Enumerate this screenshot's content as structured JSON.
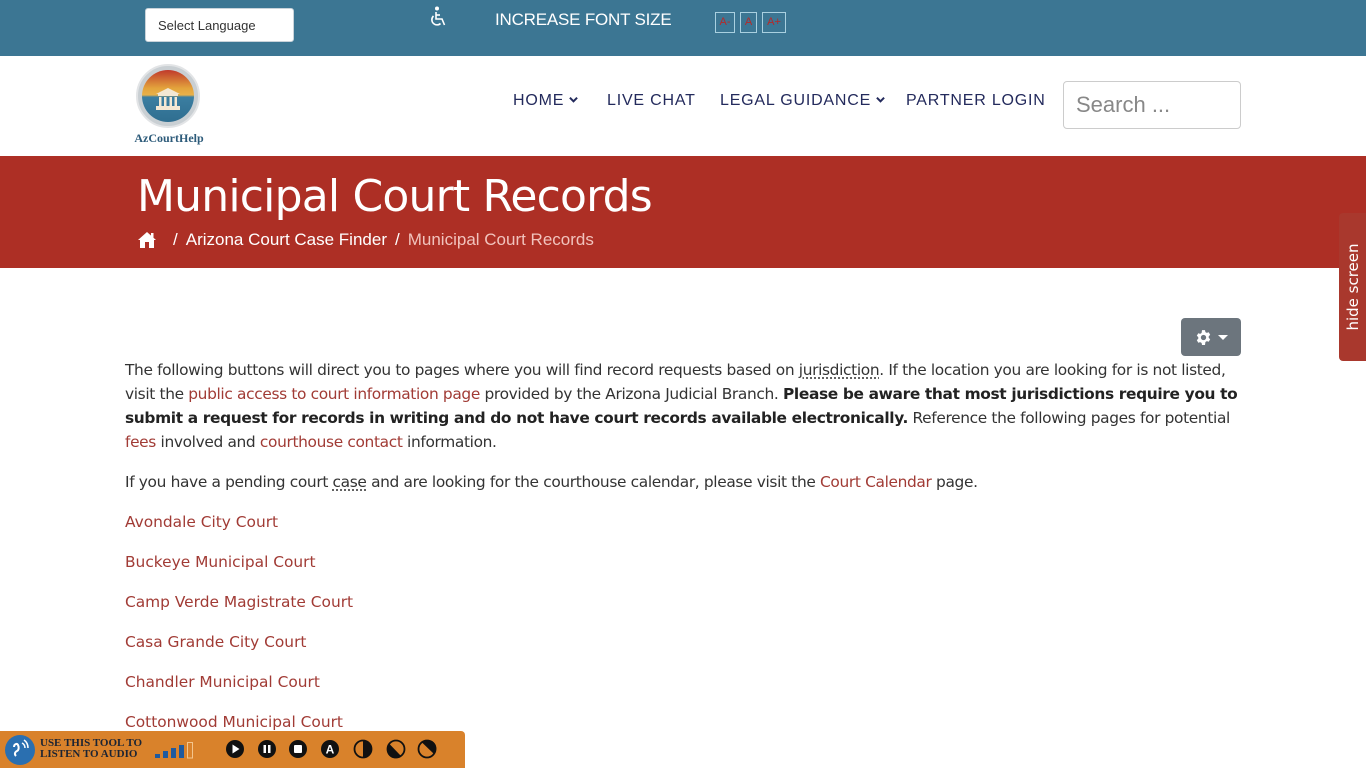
{
  "topbar": {
    "language_select": "Select Language",
    "accessibility_icon": "wheelchair-icon",
    "font_size_label": "INCREASE FONT SIZE",
    "font_buttons": [
      "A-",
      "A",
      "A+"
    ]
  },
  "header": {
    "logo_text": "AzCourtHelp",
    "nav": [
      {
        "label": "HOME",
        "has_dropdown": true
      },
      {
        "label": "LIVE CHAT",
        "has_dropdown": false
      },
      {
        "label": "LEGAL GUIDANCE",
        "has_dropdown": true
      },
      {
        "label": "PARTNER LOGIN",
        "has_dropdown": false
      }
    ],
    "search_placeholder": "Search ..."
  },
  "banner": {
    "title": "Municipal Court Records",
    "breadcrumb": [
      {
        "label": "home-icon"
      },
      {
        "label": "Arizona Court Case Finder"
      },
      {
        "label": "Municipal Court Records"
      }
    ]
  },
  "side_tab": {
    "label": "hide screen"
  },
  "content": {
    "p1": {
      "t1": "The following buttons will direct you to pages where you will find record requests based on ",
      "abbr1": "jurisdiction",
      "t2": ".  If the location you are looking for is not listed, visit the ",
      "link1": "public access to court information page",
      "t3": " provided by the Arizona Judicial Branch.  ",
      "bold": "Please be aware that most jurisdictions require you to submit a request for records in writing and do not have court records available electronically.",
      "t4": "  Reference the following pages for potential ",
      "link2": "fees",
      "t5": " involved and ",
      "link3": "courthouse contact",
      "t6": " information."
    },
    "p2": {
      "t1": "If you have a pending court ",
      "abbr1": "case",
      "t2": " and are looking for the courthouse calendar, please visit the ",
      "link1": "Court Calendar",
      "t3": " page."
    },
    "courts": [
      "Avondale City Court",
      "Buckeye Municipal Court",
      "Camp Verde Magistrate Court",
      "Casa Grande City Court",
      "Chandler Municipal Court",
      "Cottonwood Municipal Court"
    ]
  },
  "audio_tool": {
    "label_line1": "USE THIS TOOL TO",
    "label_line2": "LISTEN TO AUDIO",
    "buttons": [
      "play-icon",
      "pause-icon",
      "stop-icon",
      "text-icon",
      "contrast-icon",
      "contrast-dark-icon",
      "contrast-invert-icon"
    ]
  },
  "colors": {
    "topbar": "#3c7693",
    "banner": "#ad2f25",
    "link": "#a13b35",
    "nav": "#232a5c",
    "audio_bar": "#d9822b"
  }
}
